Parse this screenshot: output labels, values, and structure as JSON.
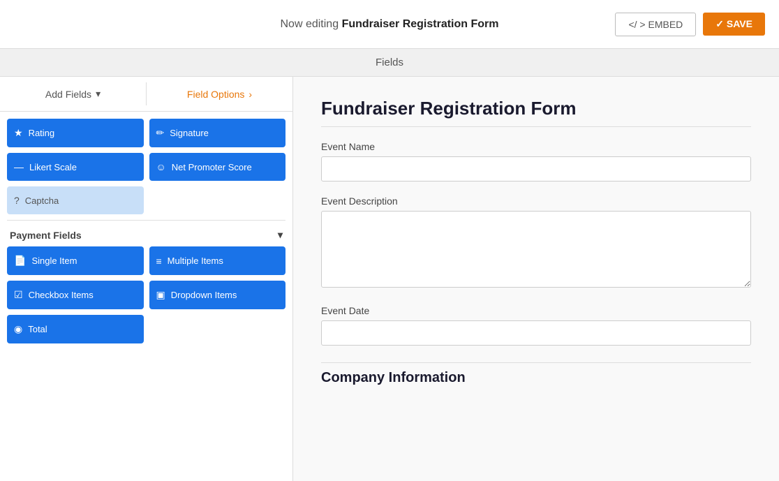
{
  "topBar": {
    "editingLabel": "Now editing",
    "formName": "Fundraiser Registration Form",
    "embedLabel": "</ > EMBED",
    "saveLabel": "✓  SAVE"
  },
  "fieldsTab": {
    "label": "Fields"
  },
  "leftPanel": {
    "addFieldsTab": "Add Fields",
    "addFieldsChevron": "▾",
    "fieldOptionsTab": "Field Options",
    "fieldOptionsChevron": "›",
    "fieldRows": [
      [
        {
          "icon": "★",
          "label": "Rating"
        },
        {
          "icon": "✏",
          "label": "Signature"
        }
      ],
      [
        {
          "icon": "—",
          "label": "Likert Scale"
        },
        {
          "icon": "☺",
          "label": "Net Promoter Score"
        }
      ],
      [
        {
          "icon": "?",
          "label": "Captcha"
        }
      ]
    ],
    "paymentSection": "Payment Fields",
    "paymentChevron": "▾",
    "paymentRows": [
      [
        {
          "icon": "📄",
          "label": "Single Item"
        },
        {
          "icon": "≡",
          "label": "Multiple Items"
        }
      ],
      [
        {
          "icon": "☑",
          "label": "Checkbox Items"
        },
        {
          "icon": "▣",
          "label": "Dropdown Items"
        }
      ],
      [
        {
          "icon": "◉",
          "label": "Total"
        }
      ]
    ]
  },
  "formPreview": {
    "title": "Fundraiser Registration Form",
    "fields": [
      {
        "label": "Event Name",
        "type": "input"
      },
      {
        "label": "Event Description",
        "type": "textarea"
      },
      {
        "label": "Event Date",
        "type": "input"
      }
    ],
    "companySection": "Company Information"
  }
}
